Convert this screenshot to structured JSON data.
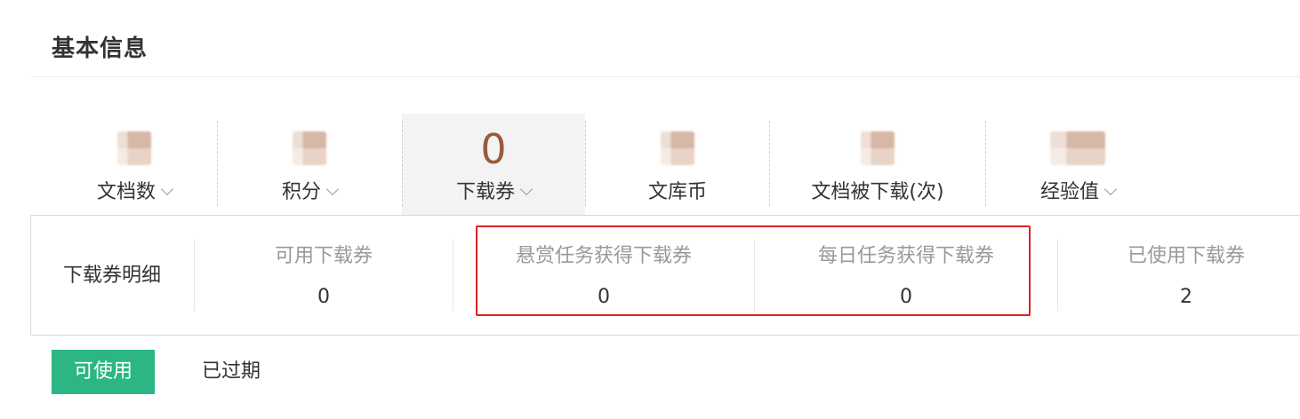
{
  "section": {
    "title": "基本信息"
  },
  "stats": [
    {
      "label": "文档数",
      "value": null,
      "has_dropdown": true
    },
    {
      "label": "积分",
      "value": null,
      "has_dropdown": true
    },
    {
      "label": "下载券",
      "value": "0",
      "has_dropdown": true,
      "active": true
    },
    {
      "label": "文库币",
      "value": null,
      "has_dropdown": false
    },
    {
      "label": "文档被下载(次)",
      "value": null,
      "has_dropdown": false
    },
    {
      "label": "经验值",
      "value": null,
      "has_dropdown": true
    }
  ],
  "detail": {
    "title": "下载券明细",
    "columns": [
      {
        "label": "可用下载券",
        "value": "0"
      },
      {
        "label": "悬赏任务获得下载券",
        "value": "0"
      },
      {
        "label": "每日任务获得下载券",
        "value": "0"
      },
      {
        "label": "已使用下载券",
        "value": "2"
      }
    ],
    "highlight_color": "#e02020"
  },
  "tabs": [
    {
      "label": "可使用",
      "active": true
    },
    {
      "label": "已过期",
      "active": false
    }
  ],
  "colors": {
    "accent": "#2bb684",
    "value_brown": "#9a5b3a"
  }
}
